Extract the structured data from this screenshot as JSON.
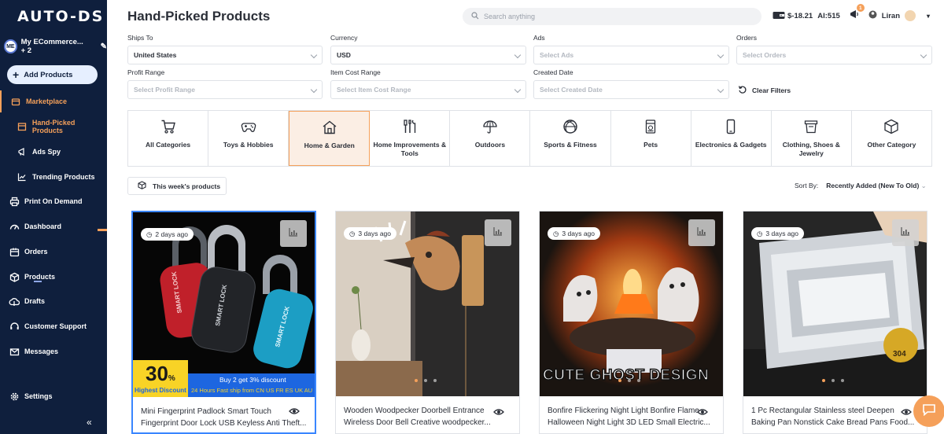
{
  "app": {
    "logo": "AUTO-DS",
    "page_title": "Hand-Picked Products"
  },
  "sidebar": {
    "store": {
      "initials": "ME",
      "name": "My ECommerce... + 2"
    },
    "add_products": "Add Products",
    "items": [
      {
        "label": "Marketplace"
      },
      {
        "label": "Hand-Picked Products"
      },
      {
        "label": "Ads Spy"
      },
      {
        "label": "Trending Products"
      },
      {
        "label": "Print On Demand"
      },
      {
        "label": "Dashboard"
      },
      {
        "label": "Orders"
      },
      {
        "label": "Products"
      },
      {
        "label": "Drafts"
      },
      {
        "label": "Customer Support"
      },
      {
        "label": "Messages"
      },
      {
        "label": "Settings"
      }
    ],
    "collapse": "«"
  },
  "header": {
    "search_placeholder": "Search anything",
    "balance": "$-18.21",
    "ai_label": "AI:",
    "ai_value": "515",
    "cart_count": "1",
    "user_name": "Liran"
  },
  "filters": {
    "ships_to": {
      "label": "Ships To",
      "value": "United States"
    },
    "currency": {
      "label": "Currency",
      "value": "USD"
    },
    "ads": {
      "label": "Ads",
      "placeholder": "Select Ads"
    },
    "orders": {
      "label": "Orders",
      "placeholder": "Select Orders"
    },
    "profit": {
      "label": "Profit Range",
      "placeholder": "Select Profit Range"
    },
    "item_cost": {
      "label": "Item Cost Range",
      "placeholder": "Select Item Cost Range"
    },
    "created": {
      "label": "Created Date",
      "placeholder": "Select Created Date"
    },
    "clear": "Clear Filters"
  },
  "categories": [
    {
      "label": "All Categories",
      "icon": "cart-icon"
    },
    {
      "label": "Toys & Hobbies",
      "icon": "gamepad-icon"
    },
    {
      "label": "Home & Garden",
      "icon": "house-icon",
      "selected": true
    },
    {
      "label": "Home Improvements & Tools",
      "icon": "tools-icon"
    },
    {
      "label": "Outdoors",
      "icon": "umbrella-icon"
    },
    {
      "label": "Sports & Fitness",
      "icon": "ball-icon"
    },
    {
      "label": "Pets",
      "icon": "pet-food-icon"
    },
    {
      "label": "Electronics & Gadgets",
      "icon": "phone-icon"
    },
    {
      "label": "Clothing, Shoes & Jewelry",
      "icon": "clothing-icon"
    },
    {
      "label": "Other Category",
      "icon": "box-icon"
    }
  ],
  "this_week": "This week's products",
  "sort": {
    "label": "Sort By:",
    "value": "Recently Added (New To Old)"
  },
  "products": [
    {
      "age": "2 days ago",
      "title": "Mini Fingerprint Padlock Smart Touch Fingerprint Door Lock USB Keyless Anti Theft...",
      "promo_big": "30",
      "promo_pct": "%",
      "promo_sub": "Highest Discount",
      "promo_line1": "Buy 2 get 3% discount",
      "promo_line2": "24 Hours Fast ship from CN US FR ES UK AU",
      "lock_text": "SMART LOCK"
    },
    {
      "age": "3 days ago",
      "title": "Wooden Woodpecker Doorbell Entrance Wireless Door Bell Creative woodpecker..."
    },
    {
      "age": "3 days ago",
      "title": "Bonfire Flickering Night Light Bonfire Flame Halloween Night Light 3D LED Small Electric...",
      "overlay": "CUTE GHOST DESIGN"
    },
    {
      "age": "3 days ago",
      "title": "1 Pc Rectangular Stainless steel Deepen Baking Pan Nonstick Cake Bread Pans Food...",
      "badge": "304"
    }
  ]
}
